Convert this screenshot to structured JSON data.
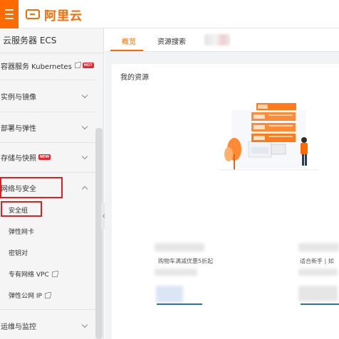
{
  "topbar": {
    "logo_text": "阿里云"
  },
  "sidebar": {
    "title": "云服务器 ECS",
    "items": [
      {
        "label": "容器服务 Kubernetes",
        "badge": "HOT"
      },
      {
        "label": "实例与镜像"
      },
      {
        "label": "部署与弹性"
      },
      {
        "label": "存储与快照",
        "badge": "NEW"
      },
      {
        "label": "网络与安全"
      },
      {
        "label": "运维与监控"
      }
    ],
    "sub_items": [
      {
        "label": "安全组"
      },
      {
        "label": "弹性网卡"
      },
      {
        "label": "密钥对"
      },
      {
        "label": "专有网络 VPC"
      },
      {
        "label": "弹性公网 IP"
      }
    ]
  },
  "tabs": [
    {
      "label": "概览"
    },
    {
      "label": "资源搜索"
    }
  ],
  "main": {
    "card_title": "我的资源",
    "promo_left": "购物车满减优惠5折起",
    "promo_right": "适合新手 | 如"
  },
  "colors": {
    "accent": "#ff6a00",
    "highlight_box": "#e02020",
    "link_blue": "#2f6fb4"
  }
}
